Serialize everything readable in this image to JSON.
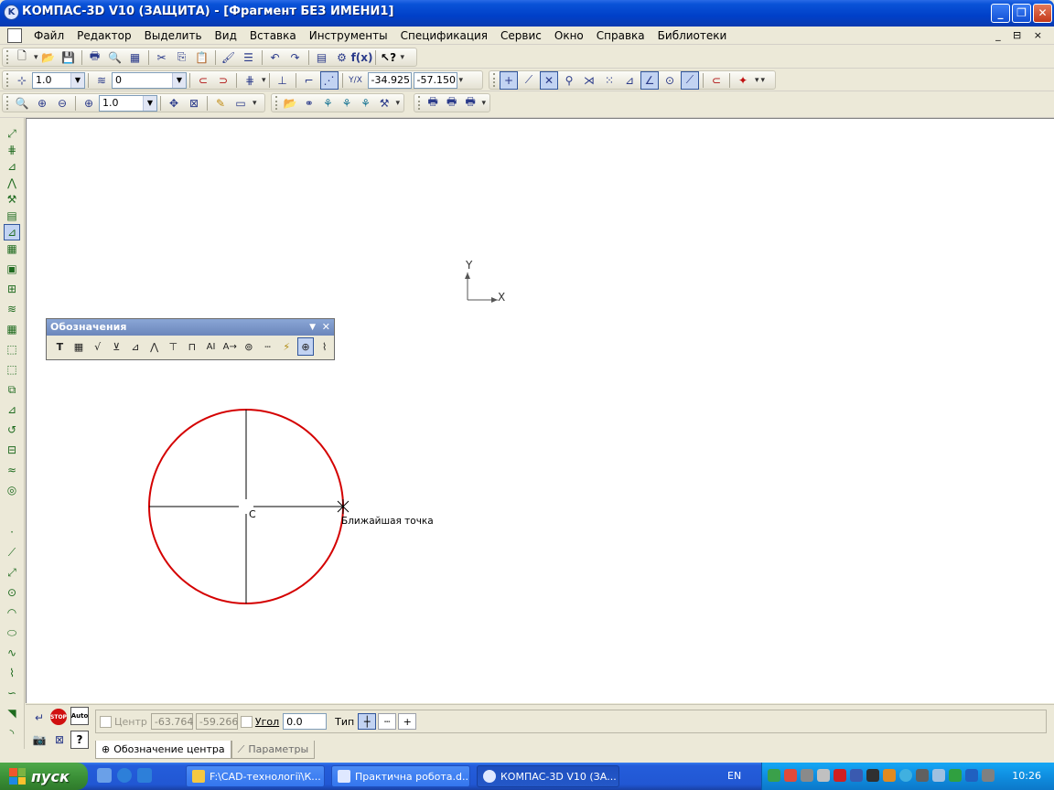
{
  "window": {
    "title": "КОМПАС-3D V10 (ЗАЩИТА) - [Фрагмент БЕЗ ИМЕНИ1]",
    "app_icon": "kompas-icon",
    "controls": {
      "minimize": "minimize-icon",
      "restore": "restore-icon",
      "close": "close-icon"
    }
  },
  "menu": {
    "items": [
      "Файл",
      "Редактор",
      "Выделить",
      "Вид",
      "Вставка",
      "Инструменты",
      "Спецификация",
      "Сервис",
      "Окно",
      "Справка",
      "Библиотеки"
    ],
    "mdi_controls": "_ ⊟ ×"
  },
  "toolbar_current_state": {
    "step": "1.0",
    "layer": "0",
    "coord_x": "-34.925",
    "coord_y": "-57.150"
  },
  "toolbar_view": {
    "zoom": "1.0"
  },
  "oboznacheniya_panel": {
    "title": "Обозначения",
    "icons": [
      "text-icon",
      "table-icon",
      "roughness-icon",
      "base-icon",
      "tolerance-icon",
      "leader-icon",
      "line-break-icon",
      "position-icon",
      "axis-marker-icon",
      "view-arrow-icon",
      "cut-line-icon",
      "dashed-line-icon",
      "cut-icon",
      "center-mark-icon",
      "wave-line-icon"
    ]
  },
  "drawing": {
    "axis_labels": {
      "y": "Y",
      "x": "X"
    },
    "center_label": "C",
    "snap_label": "Ближайшая точка",
    "circle_color": "#d40000"
  },
  "property_bar": {
    "center_label": "Центр",
    "center_x": "-63.764",
    "center_y": "-59.266",
    "angle_label": "Угол",
    "angle_value": "0.0",
    "type_label": "Тип",
    "tabs": [
      {
        "label": "Обозначение центра"
      },
      {
        "label": "Параметры"
      }
    ]
  },
  "taskbar": {
    "start": "пуск",
    "tasks": [
      {
        "label": "F:\\CAD-технології\\К..."
      },
      {
        "label": "Практична робота.d..."
      },
      {
        "label": "КОМПАС-3D V10 (ЗА..."
      }
    ],
    "lang": "EN",
    "clock": "10:26"
  }
}
